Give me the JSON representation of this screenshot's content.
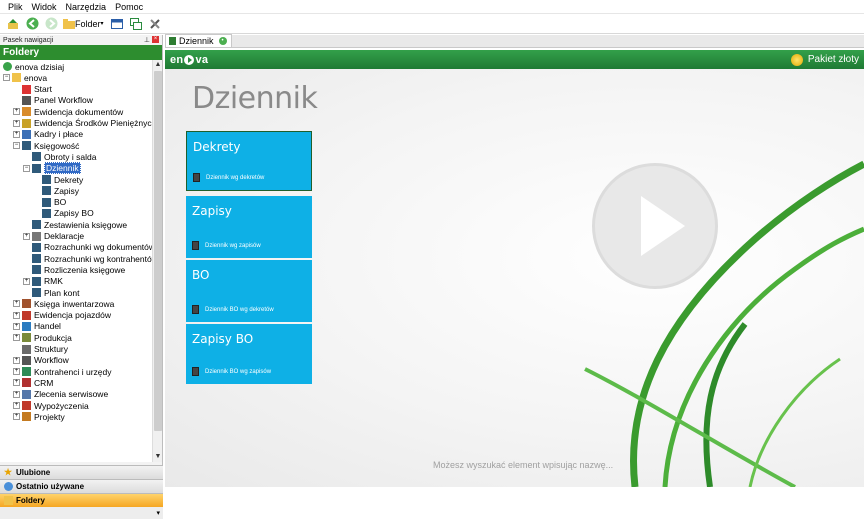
{
  "menu": [
    "Plik",
    "Widok",
    "Narzędzia",
    "Pomoc"
  ],
  "toolbar": {
    "folder_label": "Folder"
  },
  "nav": {
    "header": "Pasek nawigacji",
    "folders_title": "Foldery",
    "tree": [
      {
        "label": "enova dzisiaj",
        "level": 0,
        "exp": "",
        "icon": "green-circle-icon"
      },
      {
        "label": "enova",
        "level": 0,
        "exp": "-",
        "icon": "database-icon"
      },
      {
        "label": "Start",
        "level": 1,
        "exp": "",
        "icon": "calendar-icon"
      },
      {
        "label": "Panel Workflow",
        "level": 1,
        "exp": "",
        "icon": "workflow-icon"
      },
      {
        "label": "Ewidencja dokumentów",
        "level": 1,
        "exp": "+",
        "icon": "documents-icon"
      },
      {
        "label": "Ewidencja Środków Pieniężnych",
        "level": 1,
        "exp": "+",
        "icon": "coins-icon"
      },
      {
        "label": "Kadry i płace",
        "level": 1,
        "exp": "+",
        "icon": "people-icon"
      },
      {
        "label": "Księgowość",
        "level": 1,
        "exp": "-",
        "icon": "book-icon"
      },
      {
        "label": "Obroty i salda",
        "level": 2,
        "exp": "",
        "icon": "book-icon"
      },
      {
        "label": "Dziennik",
        "level": 2,
        "exp": "-",
        "icon": "book-icon",
        "selected": true
      },
      {
        "label": "Dekrety",
        "level": 3,
        "exp": "",
        "icon": "book-icon"
      },
      {
        "label": "Zapisy",
        "level": 3,
        "exp": "",
        "icon": "book-icon"
      },
      {
        "label": "BO",
        "level": 3,
        "exp": "",
        "icon": "book-icon"
      },
      {
        "label": "Zapisy BO",
        "level": 3,
        "exp": "",
        "icon": "book-icon"
      },
      {
        "label": "Zestawienia księgowe",
        "level": 2,
        "exp": "",
        "icon": "book-icon"
      },
      {
        "label": "Deklaracje",
        "level": 2,
        "exp": "+",
        "icon": "pen-icon"
      },
      {
        "label": "Rozrachunki wg dokumentów",
        "level": 2,
        "exp": "",
        "icon": "book-icon"
      },
      {
        "label": "Rozrachunki wg kontrahentów",
        "level": 2,
        "exp": "",
        "icon": "book-icon"
      },
      {
        "label": "Rozliczenia księgowe",
        "level": 2,
        "exp": "",
        "icon": "book-icon"
      },
      {
        "label": "RMK",
        "level": 2,
        "exp": "+",
        "icon": "book-icon"
      },
      {
        "label": "Plan kont",
        "level": 2,
        "exp": "",
        "icon": "book-icon"
      },
      {
        "label": "Księga inwentarzowa",
        "level": 1,
        "exp": "+",
        "icon": "inventory-icon"
      },
      {
        "label": "Ewidencja pojazdów",
        "level": 1,
        "exp": "+",
        "icon": "car-icon"
      },
      {
        "label": "Handel",
        "level": 1,
        "exp": "+",
        "icon": "cart-icon"
      },
      {
        "label": "Produkcja",
        "level": 1,
        "exp": "+",
        "icon": "production-icon"
      },
      {
        "label": "Struktury",
        "level": 1,
        "exp": "",
        "icon": "structure-icon"
      },
      {
        "label": "Workflow",
        "level": 1,
        "exp": "+",
        "icon": "workflow-icon"
      },
      {
        "label": "Kontrahenci i urzędy",
        "level": 1,
        "exp": "+",
        "icon": "contacts-icon"
      },
      {
        "label": "CRM",
        "level": 1,
        "exp": "+",
        "icon": "phone-icon"
      },
      {
        "label": "Zlecenia serwisowe",
        "level": 1,
        "exp": "+",
        "icon": "wrench-icon"
      },
      {
        "label": "Wypożyczenia",
        "level": 1,
        "exp": "+",
        "icon": "car-icon"
      },
      {
        "label": "Projekty",
        "level": 1,
        "exp": "+",
        "icon": "projects-icon"
      }
    ],
    "panels": [
      {
        "label": "Ulubione",
        "icon": "star-icon",
        "active": false
      },
      {
        "label": "Ostatnio używane",
        "icon": "clock-icon",
        "active": false
      },
      {
        "label": "Foldery",
        "icon": "folder-icon",
        "active": true
      }
    ]
  },
  "tab": {
    "label": "Dziennik"
  },
  "header": {
    "logo_left": "en",
    "logo_right": "va",
    "package": "Pakiet złoty"
  },
  "main": {
    "title": "Dziennik",
    "tiles": [
      {
        "title": "Dekrety",
        "sub": "Dziennik wg dekretów"
      },
      {
        "title": "Zapisy",
        "sub": "Dziennik wg zapisów"
      },
      {
        "title": "BO",
        "sub": "Dziennik BO wg dekretów"
      },
      {
        "title": "Zapisy BO",
        "sub": "Dziennik BO wg zapisów"
      }
    ],
    "hint": "Możesz wyszukać element wpisując nazwę..."
  },
  "colors": {
    "brand_green": "#2d8d2f",
    "tile_blue": "#0eb0e6",
    "selected": "#316ac5",
    "active_panel": "#f5a623"
  }
}
